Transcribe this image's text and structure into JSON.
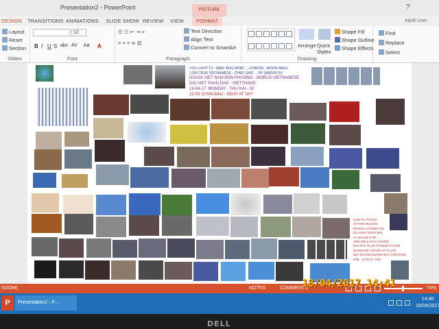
{
  "window": {
    "title": "Presentation2 - PowerPoint",
    "context_tab": "PICTURE TOOLS",
    "help": "?"
  },
  "tabs": {
    "items": [
      "DESIGN",
      "TRANSITIONS",
      "ANIMATIONS",
      "SLIDE SHOW",
      "REVIEW",
      "VIEW"
    ],
    "format": "FORMAT",
    "user": "Adult User"
  },
  "ribbon": {
    "slides": {
      "layout": "Layout",
      "reset": "Reset",
      "section": "Section",
      "label": "Slides"
    },
    "font": {
      "size": "12",
      "label": "Font",
      "bold": "B",
      "italic": "I",
      "underline": "U",
      "strike": "S",
      "abc": "abc",
      "spacing": "AV",
      "case": "Aa"
    },
    "paragraph": {
      "text_direction": "Text Direction",
      "align_text": "Align Text",
      "convert_smartart": "Convert to SmartArt",
      "label": "Paragraph"
    },
    "drawing": {
      "arrange": "Arrange",
      "quick_styles": "Quick Styles",
      "shape_fill": "Shape Fill",
      "shape_outline": "Shape Outline",
      "shape_effects": "Shape Effects",
      "label": "Drawing"
    },
    "editing": {
      "find": "Find",
      "replace": "Replace",
      "select": "Select"
    }
  },
  "slide": {
    "header_lines": [
      "YOU LIGHT TV - NEW: BUG WHAT ... LONDON - MOON WALK",
      "1,000 TRUE VIETNAMESE - CHIEF SAID ... BY SAMVIN VU",
      "NGUOI VIET NAM BON PHUONG - WORLD VIETNAMESE",
      "DAI VIET THAN DAO - VIETTHANS"
    ],
    "date_line_1": "18-04-17: MONDAY - THU HAI - 02",
    "date_line_2": "22-03: DYAN DAU - NGAY AT SKY",
    "notes": [
      "CAM THI TOI RUI",
      "CO THE MUA ROI",
      "DUONG LO RUNG HAI",
      "DO CHAY THOAI MAI",
      "17-16 GHE 6 TOI",
      "VINH RIE 6 CHAY THI ROI",
      "DUA NAY TA LIE TA NGOI TA CHOI",
      "DUONG DE VUONG VA TA LAN",
      "KET XE DOC DUONG BUY CAM HANG",
      "2:58 : 17-04-17: 6:59"
    ]
  },
  "status": {
    "left": "GDOM)",
    "notes": "NOTES",
    "comments": "COMMENTS",
    "zoom": "74%"
  },
  "taskbar": {
    "app_icon": "P",
    "task": "Presentation2 - P...",
    "time": "14:40",
    "date": "18/04/2017"
  },
  "camera_stamp": "18/04/2017  14:41",
  "bezel_logo": "DELL",
  "colors": {
    "accent": "#d6522e",
    "taskbar": "#1f6fb8",
    "stamp": "#ffb000"
  }
}
